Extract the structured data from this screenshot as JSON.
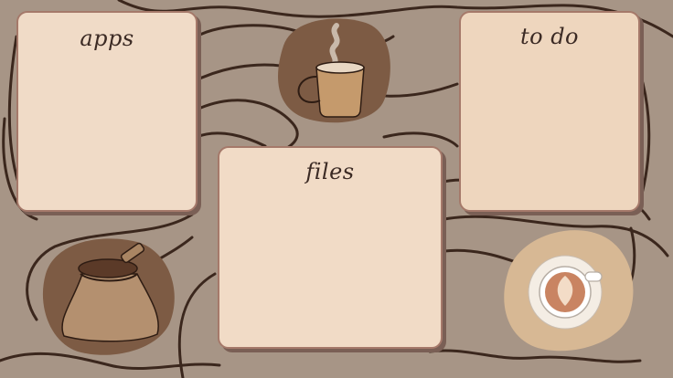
{
  "colors": {
    "background": "#a79586",
    "line": "#3b271d",
    "panel_fill": "#f0dbc7",
    "panel_border": "#a5796a",
    "blob": "#7d5b44",
    "blob_light": "#d7b894"
  },
  "panels": {
    "apps": {
      "title": "apps",
      "fill": "#f0dbc7"
    },
    "todo": {
      "title": "to do",
      "fill": "#eed6be"
    },
    "files": {
      "title": "files",
      "fill": "#f1dbc6"
    }
  },
  "decorations": {
    "top_icon": "hot-coffee-mug-icon",
    "bottom_left_icon": "coffee-bean-sack-icon",
    "bottom_right_icon": "latte-cup-icon"
  }
}
